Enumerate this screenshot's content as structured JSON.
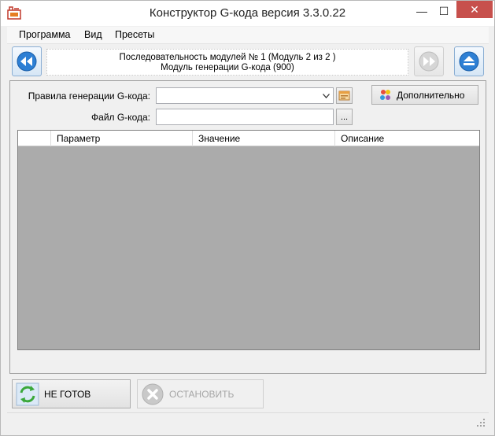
{
  "window": {
    "title": "Конструктор G-кода версия 3.3.0.22",
    "minimize_glyph": "—",
    "maximize_glyph": "☐",
    "close_glyph": "✕"
  },
  "menu": {
    "items": [
      "Программа",
      "Вид",
      "Пресеты"
    ]
  },
  "sequence": {
    "line1": "Последовательность модулей № 1 (Модуль 2 из 2 )",
    "line2": "Модуль генерации G-кода (900)"
  },
  "form": {
    "rules_label": "Правила генерации G-кода:",
    "rules_value": "",
    "file_label": "Файл G-кода:",
    "file_value": "",
    "browse_label": "...",
    "extra_button": "Дополнительно"
  },
  "grid": {
    "columns": [
      "",
      "Параметр",
      "Значение",
      "Описание"
    ]
  },
  "actions": {
    "ready_label": "НЕ ГОТОВ",
    "stop_label": "ОСТАНОВИТЬ"
  },
  "colors": {
    "close_button": "#c7504c",
    "grid_background": "#ababab",
    "accent_blue": "#1e6cc0"
  }
}
